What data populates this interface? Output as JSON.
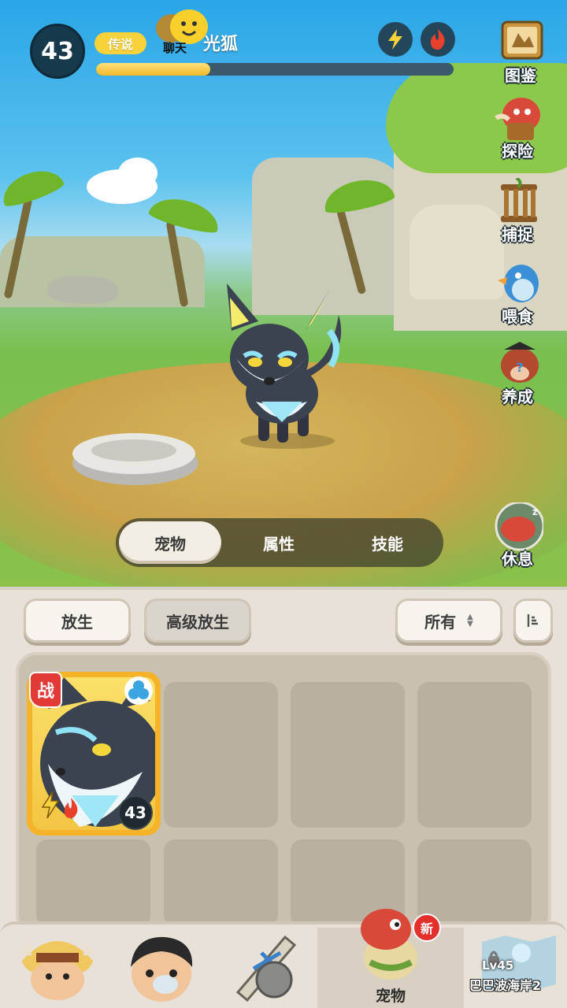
{
  "hud": {
    "level": "43",
    "rarity": "传说",
    "pet_name": "光狐",
    "chat_label": "聊天",
    "xp_progress": 0.32,
    "icons": [
      "lightning-icon",
      "fire-icon"
    ]
  },
  "side_menu": [
    {
      "label": "图鉴",
      "icon": "encyclopedia-icon"
    },
    {
      "label": "探险",
      "icon": "adventure-icon"
    },
    {
      "label": "捕捉",
      "icon": "capture-cage-icon"
    },
    {
      "label": "喂食",
      "icon": "feed-icon"
    },
    {
      "label": "养成",
      "icon": "training-icon"
    },
    {
      "label": "休息",
      "icon": "rest-icon"
    }
  ],
  "tabs": [
    {
      "label": "宠物",
      "active": true
    },
    {
      "label": "属性",
      "active": false
    },
    {
      "label": "技能",
      "active": false
    }
  ],
  "actions": {
    "release": "放生",
    "advanced_release": "高级放生",
    "filter": "所有"
  },
  "pet_card": {
    "battle_tag": "战",
    "level": "43",
    "element_icons": [
      "lightning-icon",
      "fire-icon"
    ],
    "type_icon": "water-type-icon"
  },
  "bottom_nav": [
    {
      "label": "",
      "icon": "beast-tribe-icon"
    },
    {
      "label": "",
      "icon": "trainer-icon"
    },
    {
      "label": "",
      "icon": "equipment-icon"
    },
    {
      "label": "宠物",
      "icon": "pet-dino-icon",
      "badge": "新",
      "active": true
    },
    {
      "label": "巴巴波海岸2",
      "icon": "map-icon",
      "lock": "Lv45"
    }
  ],
  "colors": {
    "accent": "#f7d23a",
    "level_badge": "#16394b",
    "battle_tag": "#e23b37",
    "card_border": "#f5b32a"
  }
}
